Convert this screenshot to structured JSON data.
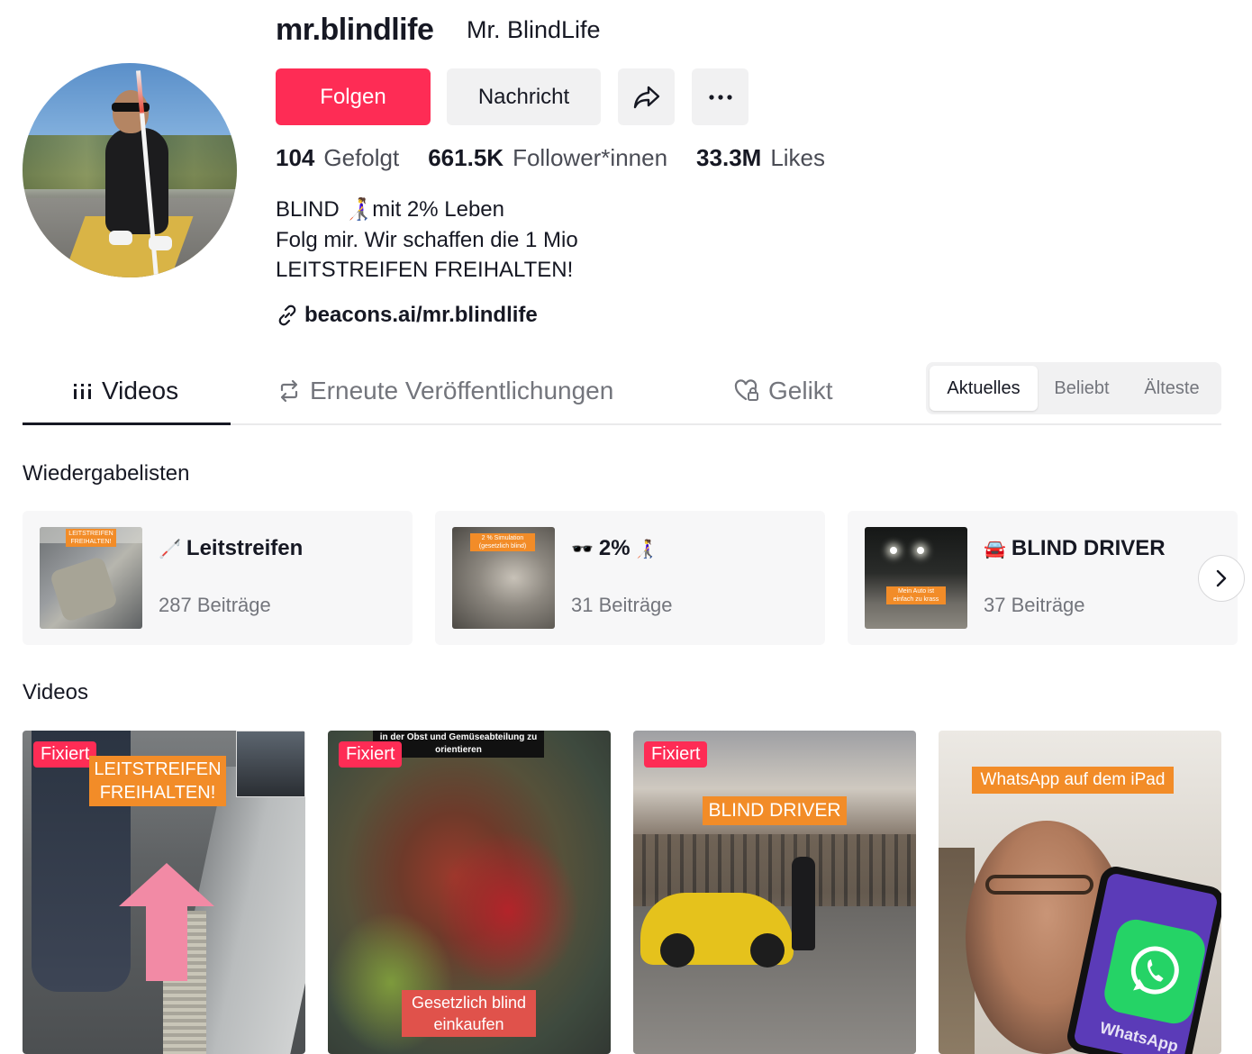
{
  "profile": {
    "username": "mr.blindlife",
    "nickname": "Mr. BlindLife",
    "follow_label": "Folgen",
    "message_label": "Nachricht",
    "stats": {
      "following_count": "104",
      "following_label": "Gefolgt",
      "followers_count": "661.5K",
      "followers_label": "Follower*innen",
      "likes_count": "33.3M",
      "likes_label": "Likes"
    },
    "bio": [
      "BLIND 👩‍🦯mit 2% Leben",
      "Folg mir. Wir schaffen die 1 Mio",
      "LEITSTREIFEN FREIHALTEN!"
    ],
    "link": "beacons.ai/mr.blindlife"
  },
  "tabs": {
    "videos": "Videos",
    "reposts": "Erneute Veröffentlichungen",
    "liked": "Gelikt"
  },
  "sort": {
    "latest": "Aktuelles",
    "popular": "Beliebt",
    "oldest": "Älteste"
  },
  "playlists_title": "Wiedergabelisten",
  "playlists": [
    {
      "emoji": "🦯",
      "title": "Leitstreifen",
      "count": "287 Beiträge",
      "thumb_text": "LEITSTREIFEN FREIHALTEN!"
    },
    {
      "emoji": "🕶️",
      "title": "2%",
      "emoji_after": "👩‍🦯",
      "count": "31 Beiträge",
      "thumb_text": "2 % Simulation (gesetzlich blind)"
    },
    {
      "emoji": "🚘",
      "title": "BLIND DRIVER",
      "count": "37 Beiträge",
      "thumb_text": "Mein Auto ist einfach zu krass"
    }
  ],
  "videos_title": "Videos",
  "videos": [
    {
      "pinned": "Fixiert",
      "label": "LEITSTREIFEN FREIHALTEN!"
    },
    {
      "pinned": "Fixiert",
      "caption_top": "in der Obst und Gemüseabteilung zu orientieren",
      "label": "Gesetzlich blind einkaufen"
    },
    {
      "pinned": "Fixiert",
      "label": "BLIND DRIVER"
    },
    {
      "label": "WhatsApp auf dem iPad",
      "screen_text": "WhatsApp"
    }
  ],
  "colors": {
    "primary": "#fe2c55",
    "text": "#161823",
    "secondary_text": "#73757c",
    "button_bg": "#f1f1f2",
    "label_orange": "#f28c28"
  }
}
